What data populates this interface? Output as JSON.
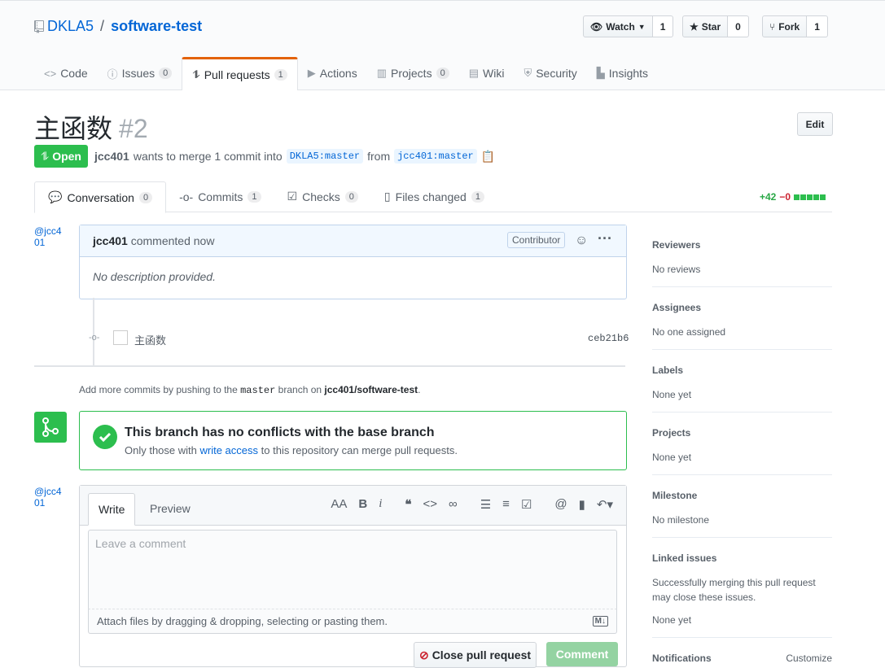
{
  "repo": {
    "owner": "DKLA5",
    "separator": "/",
    "name": "software-test"
  },
  "actions": {
    "watch": {
      "label": "Watch",
      "count": "1"
    },
    "star": {
      "label": "Star",
      "count": "0"
    },
    "fork": {
      "label": "Fork",
      "count": "1"
    }
  },
  "nav": [
    {
      "label": "Code",
      "count": ""
    },
    {
      "label": "Issues",
      "count": "0"
    },
    {
      "label": "Pull requests",
      "count": "1"
    },
    {
      "label": "Actions",
      "count": ""
    },
    {
      "label": "Projects",
      "count": "0"
    },
    {
      "label": "Wiki",
      "count": ""
    },
    {
      "label": "Security",
      "count": ""
    },
    {
      "label": "Insights",
      "count": ""
    }
  ],
  "pr": {
    "title": "主函数",
    "number": "#2",
    "state": "Open",
    "author": "jcc401",
    "merge_text": "wants to merge 1 commit into",
    "base": "DKLA5:master",
    "from": "from",
    "head": "jcc401:master",
    "edit": "Edit"
  },
  "subtabs": [
    {
      "label": "Conversation",
      "count": "0"
    },
    {
      "label": "Commits",
      "count": "1"
    },
    {
      "label": "Checks",
      "count": "0"
    },
    {
      "label": "Files changed",
      "count": "1"
    }
  ],
  "diffstat": {
    "add": "+42",
    "del": "−0"
  },
  "comment": {
    "avatar_alt": "@jcc401",
    "author": "jcc401",
    "time": "commented now",
    "badge": "Contributor",
    "body": "No description provided."
  },
  "commit": {
    "message": "主函数",
    "sha": "ceb21b6"
  },
  "push_hint": {
    "pre": "Add more commits by pushing to the",
    "branch": "master",
    "mid": "branch on",
    "repo": "jcc401/software-test",
    "end": "."
  },
  "merge": {
    "title": "This branch has no conflicts with the base branch",
    "pre": "Only those with",
    "link": "write access",
    "post": "to this repository can merge pull requests."
  },
  "editor": {
    "tab_write": "Write",
    "tab_preview": "Preview",
    "placeholder": "Leave a comment",
    "attach": "Attach files by dragging & dropping, selecting or pasting them.",
    "close_btn": "Close pull request",
    "comment_btn": "Comment"
  },
  "sidebar": {
    "reviewers": {
      "h": "Reviewers",
      "v": "No reviews"
    },
    "assignees": {
      "h": "Assignees",
      "v": "No one assigned"
    },
    "labels": {
      "h": "Labels",
      "v": "None yet"
    },
    "projects": {
      "h": "Projects",
      "v": "None yet"
    },
    "milestone": {
      "h": "Milestone",
      "v": "No milestone"
    },
    "linked": {
      "h": "Linked issues",
      "v": "Successfully merging this pull request may close these issues.",
      "v2": "None yet"
    },
    "notifications": {
      "h": "Notifications",
      "customize": "Customize"
    }
  },
  "colors": {
    "green": "#2cbe4e",
    "link": "#0366d6",
    "orange": "#e36209",
    "red": "#cb2431"
  }
}
